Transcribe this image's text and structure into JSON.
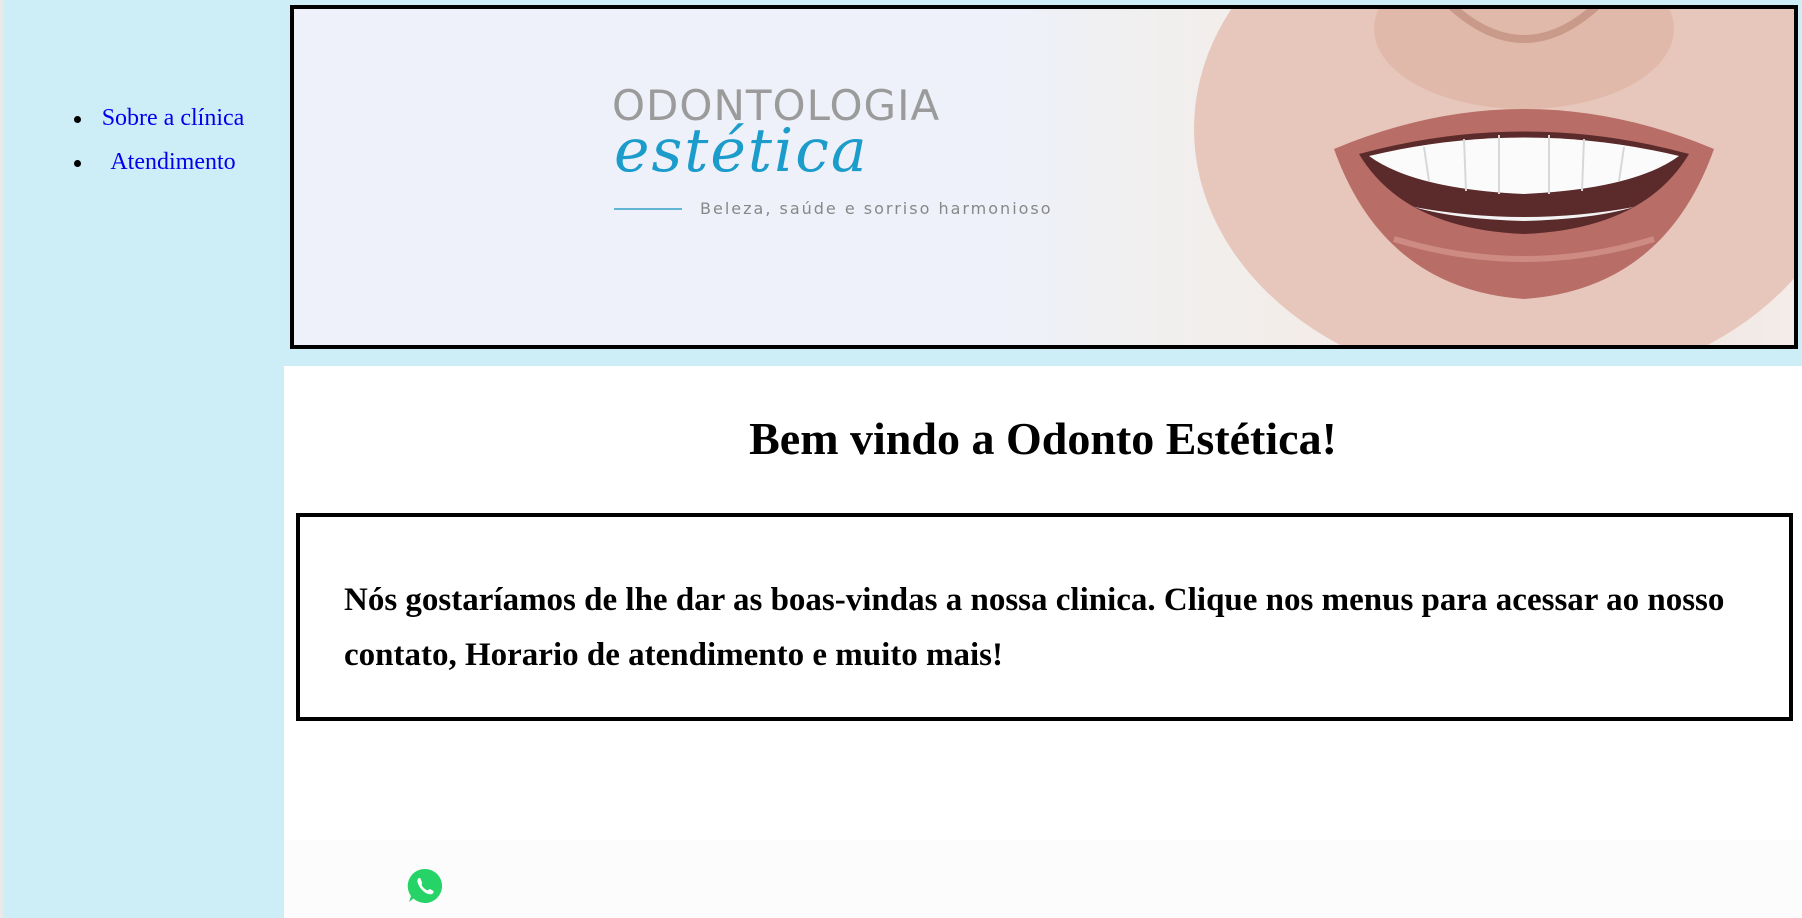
{
  "sidebar": {
    "items": [
      {
        "label": "Sobre a clínica"
      },
      {
        "label": "Atendimento"
      }
    ]
  },
  "banner": {
    "brand_top": "ODONTOLOGIA",
    "brand_script": "estética",
    "tagline": "Beleza, saúde e sorriso harmonioso"
  },
  "main": {
    "title": "Bem vindo a Odonto Estética!",
    "intro": "Nós gostaríamos de lhe dar as boas-vindas a nossa clinica. Clique nos menus para acessar ao nosso contato, Horario de atendimento e muito mais!"
  },
  "icons": {
    "whatsapp": "whatsapp-icon"
  },
  "colors": {
    "sidebar_bg": "#ceeef7",
    "link": "#0000ee",
    "brand_blue": "#1b9ccb",
    "whatsapp_green": "#25d366"
  }
}
